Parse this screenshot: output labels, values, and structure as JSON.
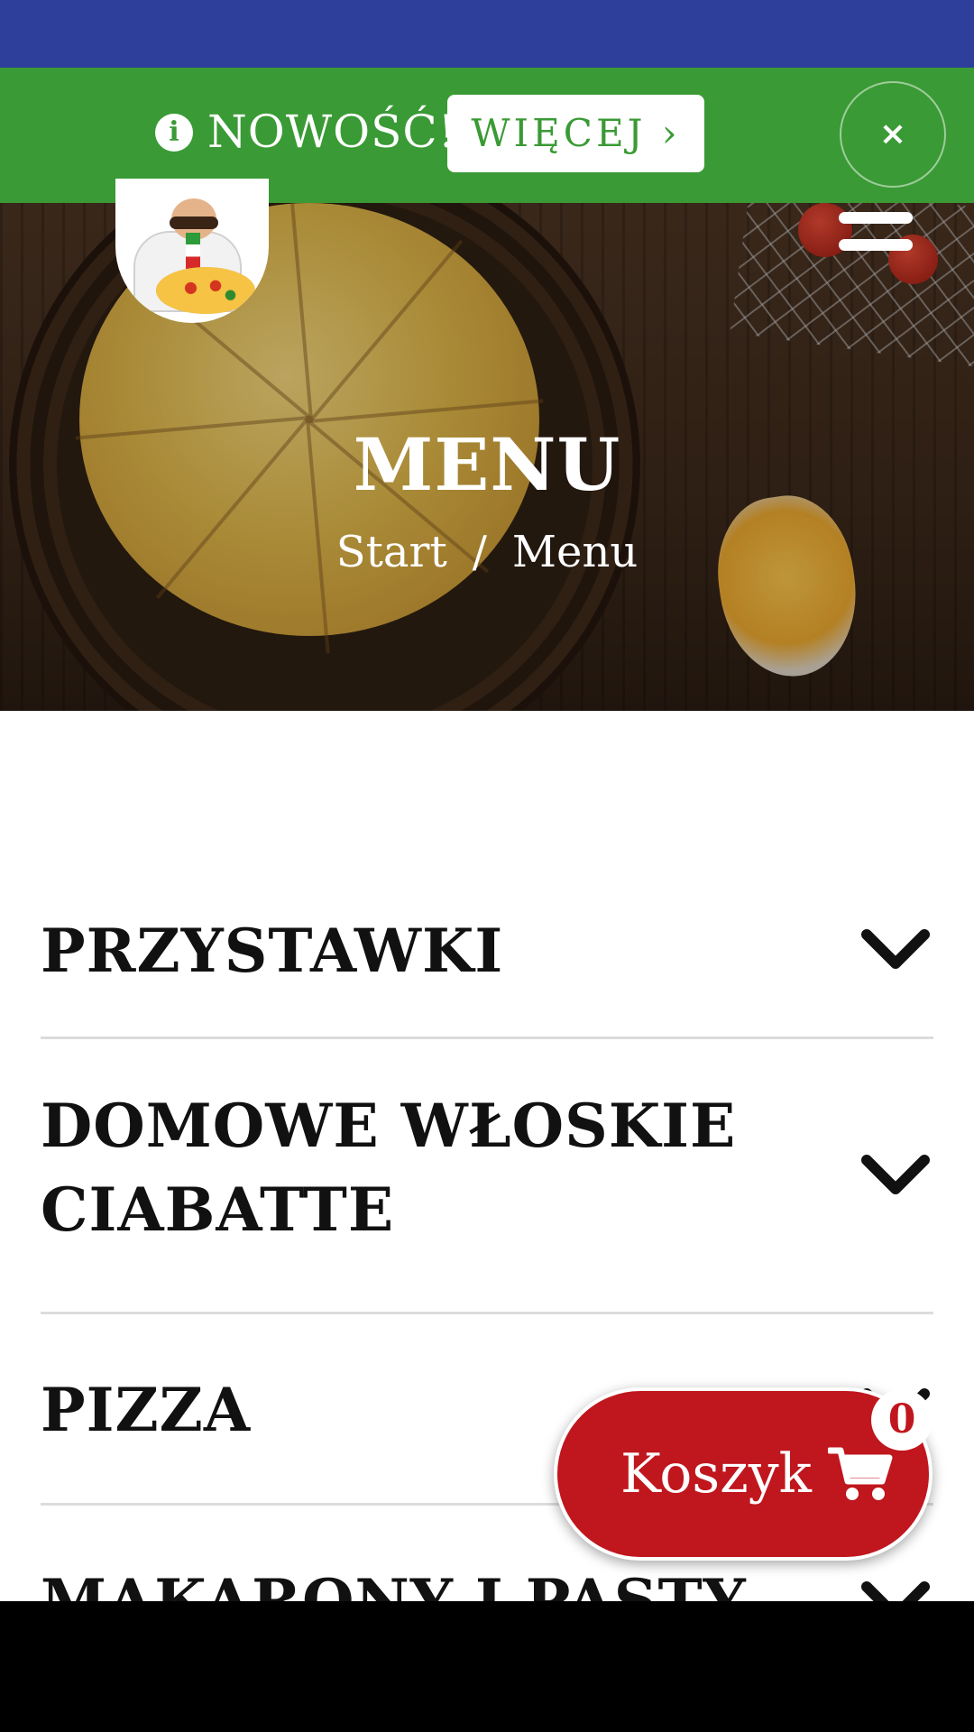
{
  "promo": {
    "info_icon": "info-icon",
    "text": "NOWOŚĆ!",
    "button_label": "WIĘCEJ ›",
    "close_label": "×"
  },
  "header": {
    "logo": "chef-pizza-logo",
    "menu_icon": "hamburger-icon"
  },
  "hero": {
    "title": "MENU",
    "breadcrumb": [
      "Start",
      "/",
      "Menu"
    ]
  },
  "menu_categories": [
    {
      "label": "PRZYSTAWKI"
    },
    {
      "label": "DOMOWE WŁOSKIE CIABATTE",
      "line1": "DOMOWE WŁOSKIE",
      "line2": "CIABATTE"
    },
    {
      "label": "PIZZA"
    },
    {
      "label": "MAKARONY I PASTY"
    }
  ],
  "cart": {
    "label": "Koszyk",
    "icon": "cart-icon",
    "count": "0"
  },
  "colors": {
    "status_bar": "#2e3f9b",
    "promo_green": "#3a9a35",
    "cart_red": "#c0161d"
  }
}
